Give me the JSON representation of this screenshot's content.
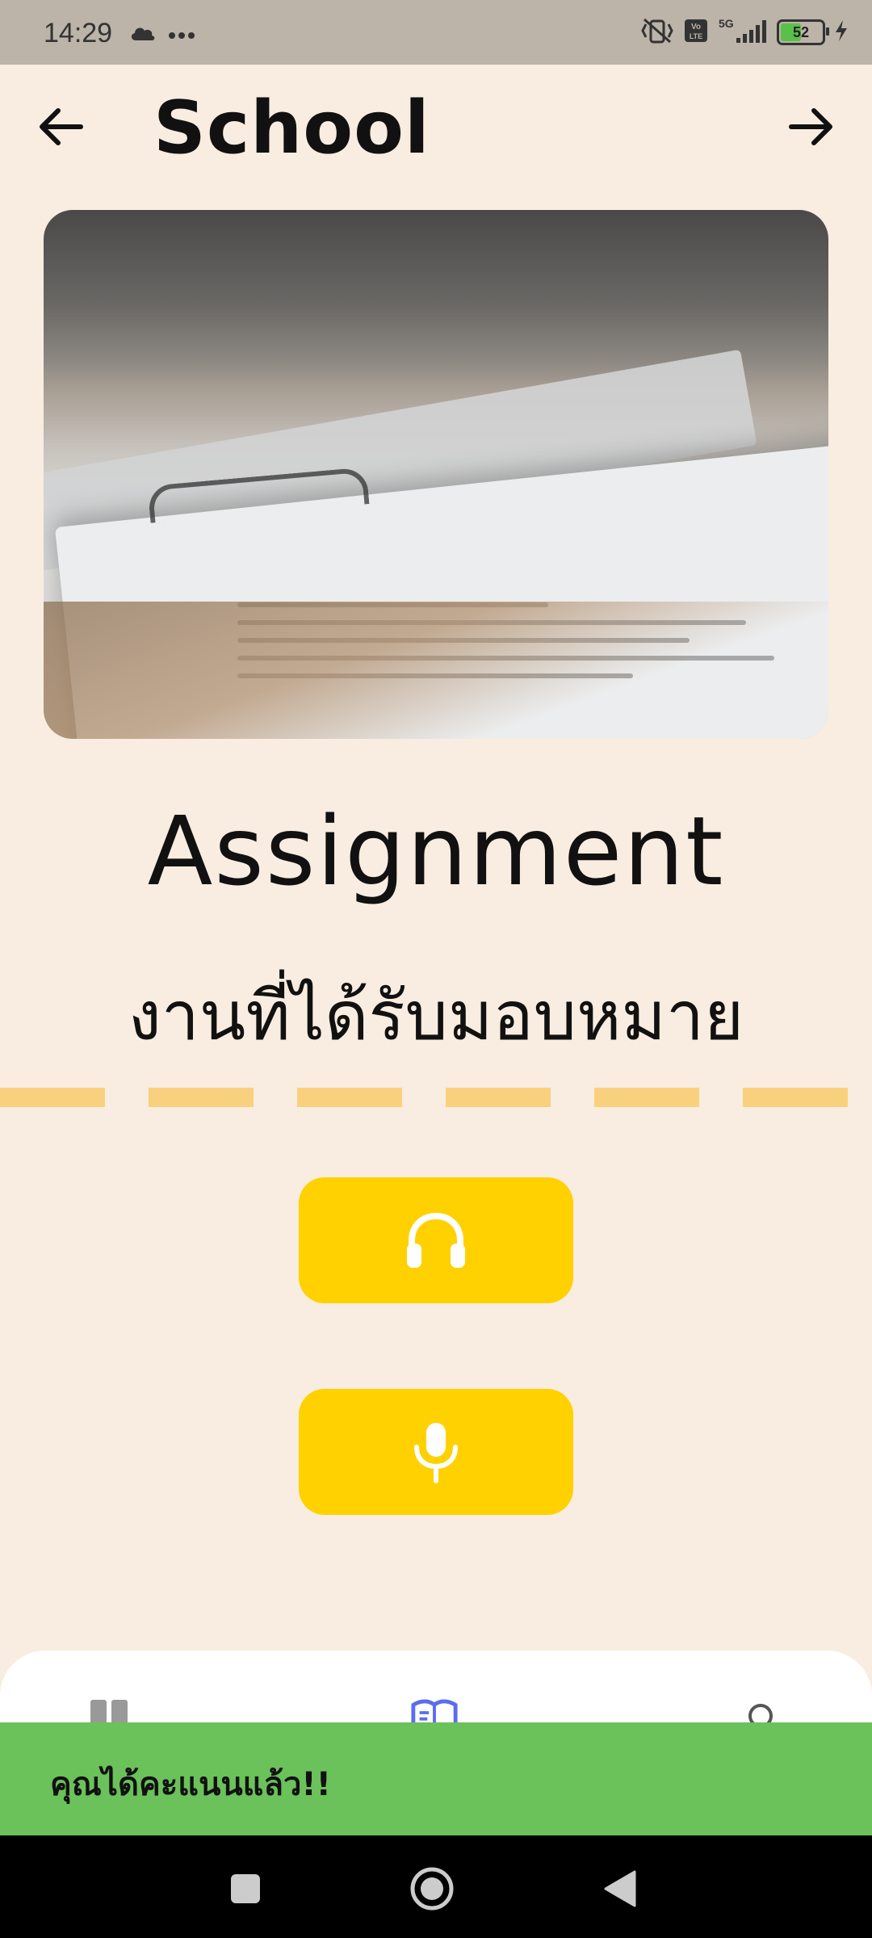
{
  "status_bar": {
    "time": "14:29",
    "battery_percent": 52,
    "battery_label": "52",
    "network_label": "5G",
    "volte_label": "Vo LTE"
  },
  "app_bar": {
    "title": "School"
  },
  "content": {
    "heading_en": "Assignment",
    "heading_th": "งานที่ได้รับมอบหมาย"
  },
  "actions": [
    {
      "icon": "headphones-icon"
    },
    {
      "icon": "microphone-icon"
    }
  ],
  "bottom_nav": {
    "items": [
      {
        "icon": "home-icon"
      },
      {
        "icon": "book-icon",
        "active": true
      },
      {
        "icon": "profile-icon"
      }
    ]
  },
  "snackbar": {
    "message": "คุณได้คะแนนแล้ว!!"
  },
  "colors": {
    "background": "#F8EDE0",
    "accent_yellow": "#FFD100",
    "divider": "#F9D07E",
    "snackbar": "#6BC15A",
    "active_nav": "#5B6CF0"
  }
}
